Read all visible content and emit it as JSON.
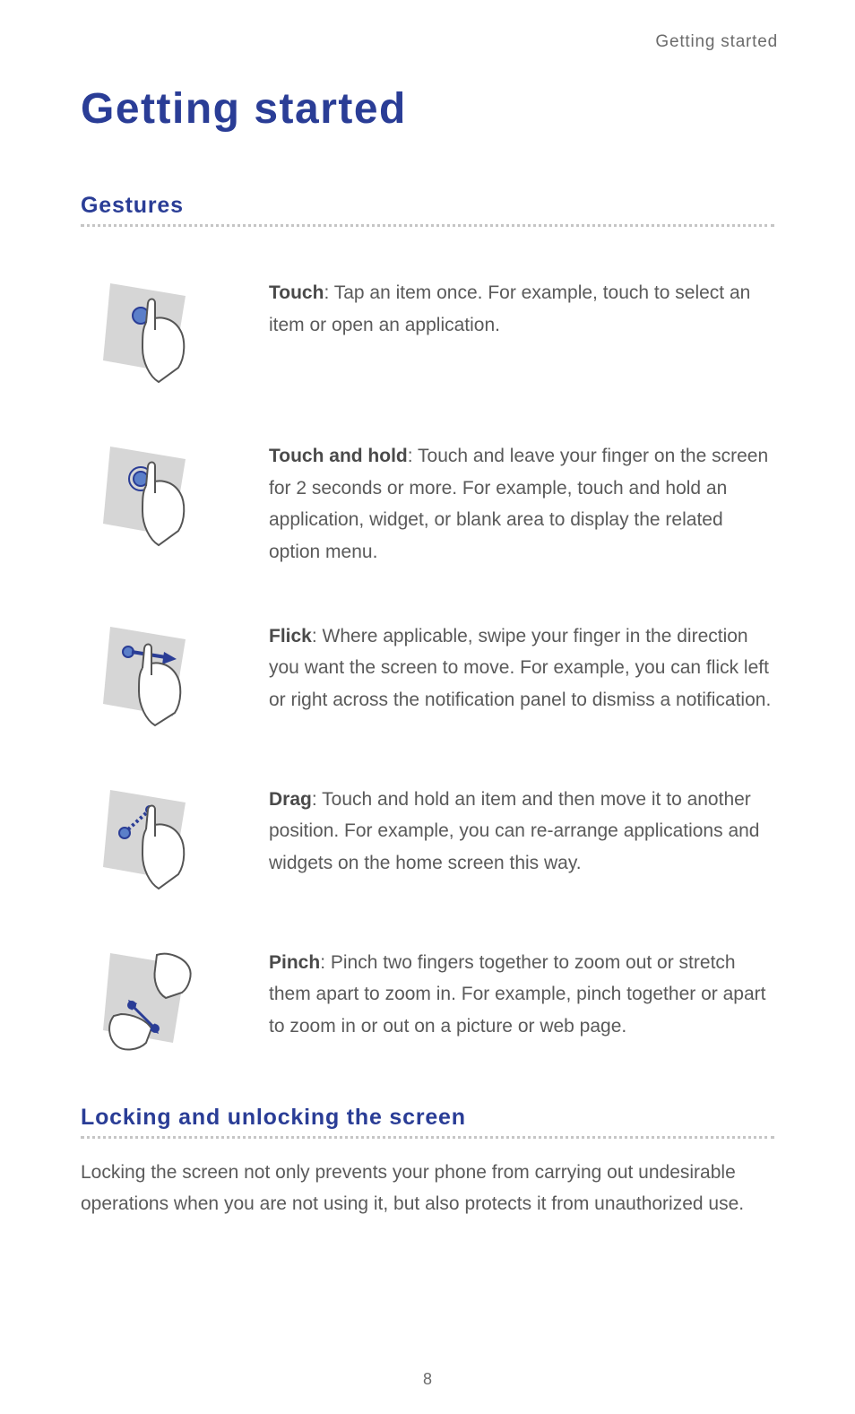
{
  "breadcrumb": "Getting started",
  "title": "Getting started",
  "section1": {
    "heading": "Gestures",
    "items": [
      {
        "term": "Touch",
        "desc": ": Tap an item once. For example, touch to select an item or open an application."
      },
      {
        "term": "Touch and hold",
        "desc": ": Touch and leave your finger on the screen for 2 seconds or more. For example, touch and hold an application, widget, or blank area to display the related option menu."
      },
      {
        "term": "Flick",
        "desc": ": Where applicable, swipe your finger in the direction you want the screen to move. For example, you can flick left or right across the notification panel to dismiss a notification."
      },
      {
        "term": "Drag",
        "desc": ": Touch and hold an item and then move it to another position. For example, you can re-arrange applications and widgets on the home screen this way."
      },
      {
        "term": "Pinch",
        "desc": ": Pinch two fingers together to zoom out or stretch them apart to zoom in. For example, pinch together or apart to zoom in or out on a picture or web page."
      }
    ]
  },
  "section2": {
    "heading": "Locking and unlocking the screen",
    "body": "Locking the screen not only prevents your phone from carrying out undesirable operations when you are not using it, but also protects it from unauthorized use."
  },
  "pageNumber": "8"
}
